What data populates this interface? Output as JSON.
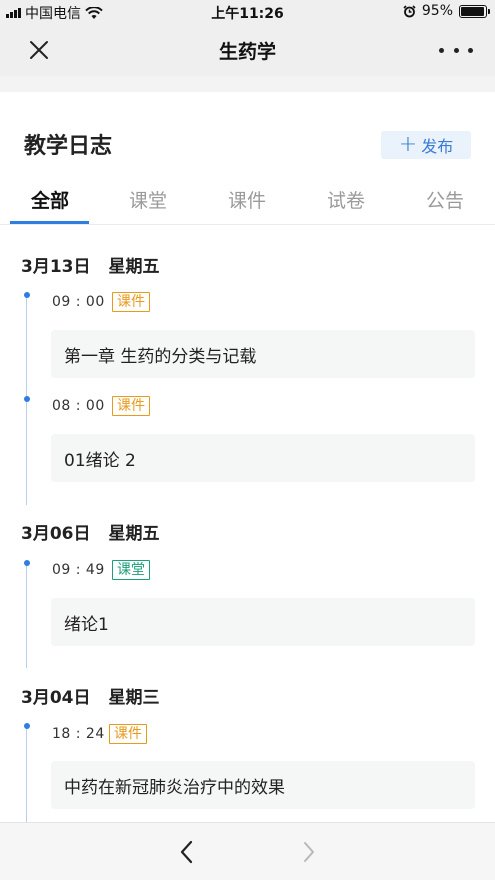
{
  "status_bar": {
    "carrier": "中国电信",
    "time": "上午11:26",
    "battery_text": "95%",
    "battery_level": 0.95,
    "icons": [
      "signal-icon",
      "wifi-icon",
      "alarm-icon",
      "battery-icon"
    ]
  },
  "nav": {
    "title": "生药学",
    "close_icon": "close-icon",
    "more_icon": "more-icon"
  },
  "header": {
    "title": "教学日志",
    "publish_label": "发布",
    "publish_icon": "plus-icon"
  },
  "tabs": [
    {
      "label": "全部",
      "active": true
    },
    {
      "label": "课堂",
      "active": false
    },
    {
      "label": "课件",
      "active": false
    },
    {
      "label": "试卷",
      "active": false
    },
    {
      "label": "公告",
      "active": false
    }
  ],
  "groups": [
    {
      "date": "3月13日",
      "weekday": "星期五",
      "entries": [
        {
          "time": "09 : 00",
          "type": "课件",
          "type_color": "#e89a1c",
          "title": "第一章 生药的分类与记载"
        },
        {
          "time": "08 : 00",
          "type": "课件",
          "type_color": "#e89a1c",
          "title": "01绪论 2"
        }
      ]
    },
    {
      "date": "3月06日",
      "weekday": "星期五",
      "entries": [
        {
          "time": "09 : 49",
          "type": "课堂",
          "type_color": "#1aa07a",
          "title": "绪论1"
        }
      ]
    },
    {
      "date": "3月04日",
      "weekday": "星期三",
      "entries": [
        {
          "time": "18 : 24",
          "type": "课件",
          "type_color": "#e89a1c",
          "title": "中药在新冠肺炎治疗中的效果"
        }
      ]
    }
  ],
  "bottom_bar": {
    "back_icon": "chevron-left-icon",
    "forward_icon": "chevron-right-icon",
    "forward_enabled": false
  },
  "colors": {
    "accent": "#2f7de1",
    "courseware": "#e89a1c",
    "classroom": "#1aa07a"
  }
}
